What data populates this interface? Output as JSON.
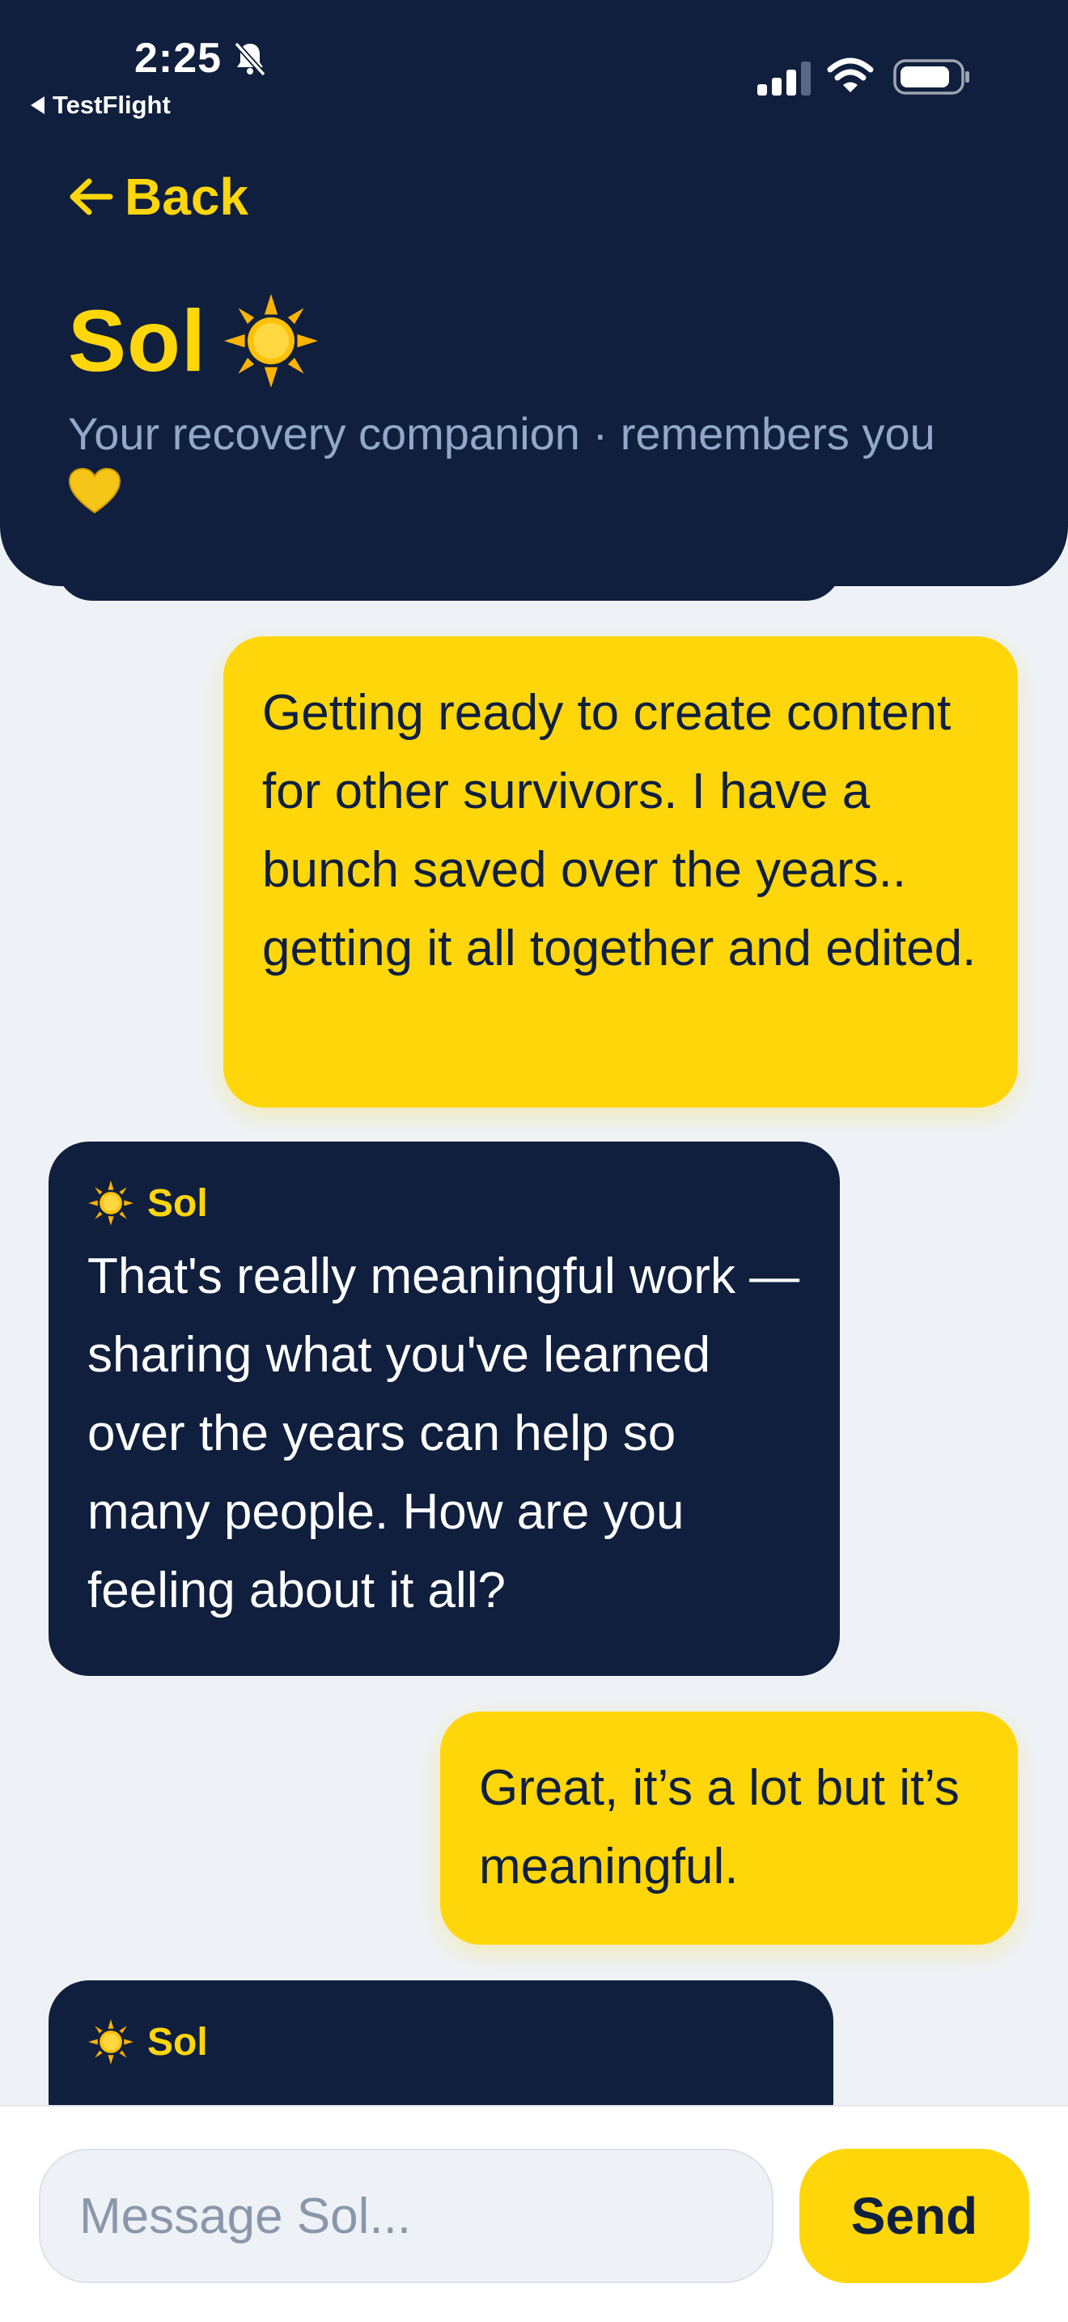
{
  "status_bar": {
    "time": "2:25",
    "back_app_label": "TestFlight"
  },
  "header": {
    "back_label": "Back",
    "title": "Sol",
    "subtitle": "Your recovery companion · remembers you"
  },
  "colors": {
    "navy": "#0f1f3d",
    "accent_yellow": "#ffd60a",
    "background": "#eef2f7",
    "subtitle": "#93a8c8"
  },
  "messages": [
    {
      "sender": "user",
      "text": "Getting ready to create content for other survivors. I have a bunch saved over the years.. getting it all together and edited."
    },
    {
      "sender": "Sol",
      "sender_label": "Sol",
      "text": "That's really meaningful work — sharing what you've learned over the years can help so many people. How are you feeling about it all?"
    },
    {
      "sender": "user",
      "text": "Great, it’s a lot but it’s meaningful."
    },
    {
      "sender": "Sol",
      "sender_label": "Sol"
    }
  ],
  "composer": {
    "placeholder": "Message Sol...",
    "send_label": "Send"
  },
  "icons": [
    "bell-slash-icon",
    "signal-icon",
    "wifi-icon",
    "battery-icon",
    "arrow-left-icon",
    "sun-icon",
    "yellow-heart-icon"
  ]
}
